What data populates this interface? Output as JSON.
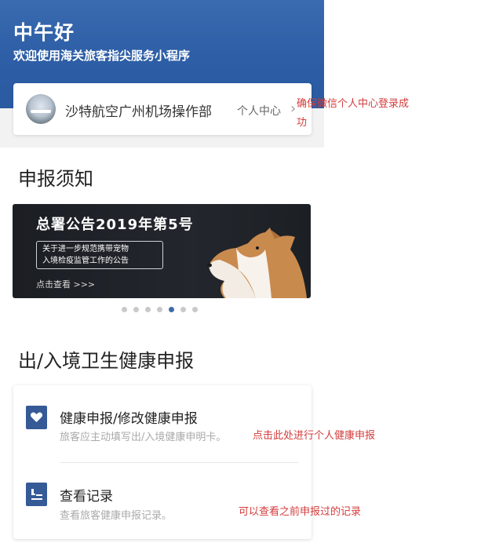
{
  "header": {
    "greeting": "中午好",
    "subtitle": "欢迎使用海关旅客指尖服务小程序"
  },
  "user_card": {
    "name": "沙特航空广州机场操作部",
    "center_link": "个人中心",
    "chevron_icon": "chevron-right-icon"
  },
  "notice_section": {
    "title": "申报须知",
    "banner": {
      "title": "总署公告2019年第5号",
      "box_lines": [
        "关于进一步规范携带宠物",
        "入境检疫监管工作的公告"
      ],
      "cta": "点击查看 >>>"
    },
    "carousel": {
      "total": 7,
      "active_index": 4
    }
  },
  "health_section": {
    "title": "出/入境卫生健康申报",
    "items": [
      {
        "icon": "heart-icon",
        "title": "健康申报/修改健康申报",
        "desc": "旅客应主动填写出/入境健康申明卡。"
      },
      {
        "icon": "record-list-icon",
        "title": "查看记录",
        "desc": "查看旅客健康申报记录。"
      }
    ]
  },
  "annotations": {
    "login_note_line1": "确保微信个人中心登录成",
    "login_note_line2": "功",
    "declare_note": "点击此处进行个人健康申报",
    "record_note": "可以查看之前申报过的记录"
  },
  "colors": {
    "header_blue": "#2d5ea6",
    "icon_blue": "#355a96",
    "annotation_red": "#d43c3c",
    "dot_active": "#3f6aa8"
  }
}
